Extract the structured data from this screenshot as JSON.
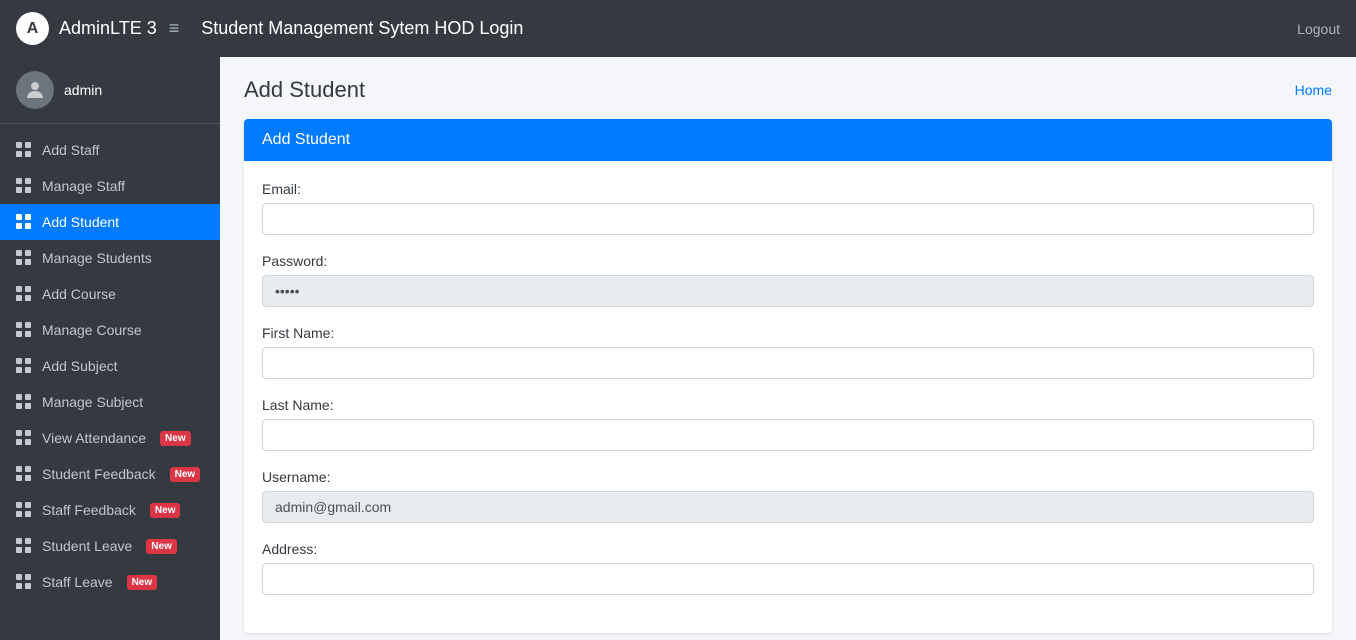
{
  "navbar": {
    "brand": "AdminLTE 3",
    "title": "Student Management Sytem HOD Login",
    "logout_label": "Logout",
    "menu_icon": "≡"
  },
  "sidebar": {
    "user": {
      "name": "admin"
    },
    "items": [
      {
        "id": "add-staff",
        "label": "Add Staff",
        "badge": null,
        "active": false
      },
      {
        "id": "manage-staff",
        "label": "Manage Staff",
        "badge": null,
        "active": false
      },
      {
        "id": "add-student",
        "label": "Add Student",
        "badge": null,
        "active": true
      },
      {
        "id": "manage-students",
        "label": "Manage Students",
        "badge": null,
        "active": false
      },
      {
        "id": "add-course",
        "label": "Add Course",
        "badge": null,
        "active": false
      },
      {
        "id": "manage-course",
        "label": "Manage Course",
        "badge": null,
        "active": false
      },
      {
        "id": "add-subject",
        "label": "Add Subject",
        "badge": null,
        "active": false
      },
      {
        "id": "manage-subject",
        "label": "Manage Subject",
        "badge": null,
        "active": false
      },
      {
        "id": "view-attendance",
        "label": "View Attendance",
        "badge": "New",
        "active": false
      },
      {
        "id": "student-feedback",
        "label": "Student Feedback",
        "badge": "New",
        "active": false
      },
      {
        "id": "staff-feedback",
        "label": "Staff Feedback",
        "badge": "New",
        "active": false
      },
      {
        "id": "student-leave",
        "label": "Student Leave",
        "badge": "New",
        "active": false
      },
      {
        "id": "staff-leave",
        "label": "Staff Leave",
        "badge": "New",
        "active": false
      }
    ]
  },
  "page": {
    "title": "Add Student",
    "breadcrumb_home": "Home",
    "card_header": "Add Student"
  },
  "form": {
    "email_label": "Email:",
    "email_value": "",
    "email_placeholder": "",
    "password_label": "Password:",
    "password_value": "•••••",
    "first_name_label": "First Name:",
    "first_name_value": "",
    "last_name_label": "Last Name:",
    "last_name_value": "",
    "username_label": "Username:",
    "username_value": "admin@gmail.com",
    "address_label": "Address:",
    "address_value": ""
  }
}
